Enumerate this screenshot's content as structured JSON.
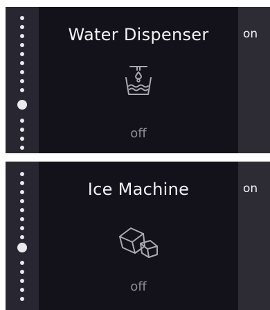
{
  "panels": [
    {
      "title": "Water Dispenser",
      "state": "off",
      "next_state": "on",
      "icon": "water-dispenser-icon"
    },
    {
      "title": "Ice Machine",
      "state": "off",
      "next_state": "on",
      "icon": "ice-cubes-icon"
    }
  ],
  "page_indicator": {
    "total_dots": 12,
    "active_index_panel_1": 9,
    "active_index_panel_2": 8
  },
  "colors": {
    "background": "#13121b",
    "rail": "#282731",
    "peek": "#2d2c35",
    "title_text": "#f3f3f6",
    "state_text": "#8e8d99",
    "icon_stroke": "#a9a8b3",
    "dot": "#e9e9ee"
  }
}
